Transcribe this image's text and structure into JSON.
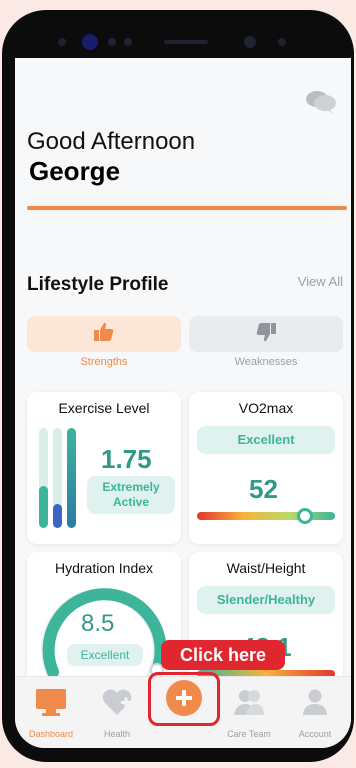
{
  "greeting": "Good Afternoon",
  "user_name": "George",
  "section": {
    "title": "Lifestyle Profile",
    "link": "View All"
  },
  "tabs": [
    {
      "label": "Strengths",
      "icon": "thumbs-up-icon",
      "active": true
    },
    {
      "label": "Weaknesses",
      "icon": "thumbs-down-icon",
      "active": false
    }
  ],
  "cards": {
    "exercise": {
      "title": "Exercise Level",
      "value": "1.75",
      "status": "Extremely\nActive",
      "status_l1": "Extremely",
      "status_l2": "Active"
    },
    "vo2": {
      "title": "VO2max",
      "status": "Excellent",
      "value": "52"
    },
    "hydration": {
      "title": "Hydration Index",
      "value": "8.5",
      "status": "Excellent"
    },
    "waist": {
      "title": "Waist/Height",
      "status": "Slender/Healthy",
      "value": "43.1"
    }
  },
  "nav": [
    {
      "label": "Dashboard",
      "icon": "monitor-icon",
      "active": true
    },
    {
      "label": "Health",
      "icon": "heart-plus-icon"
    },
    {
      "label": "",
      "icon": "plus-icon"
    },
    {
      "label": "Care Team",
      "icon": "group-icon"
    },
    {
      "label": "Account",
      "icon": "person-icon"
    }
  ],
  "callout": "Click here",
  "colors": {
    "accent": "#f08a4b",
    "teal": "#3db59b",
    "callout": "#e0262f"
  }
}
